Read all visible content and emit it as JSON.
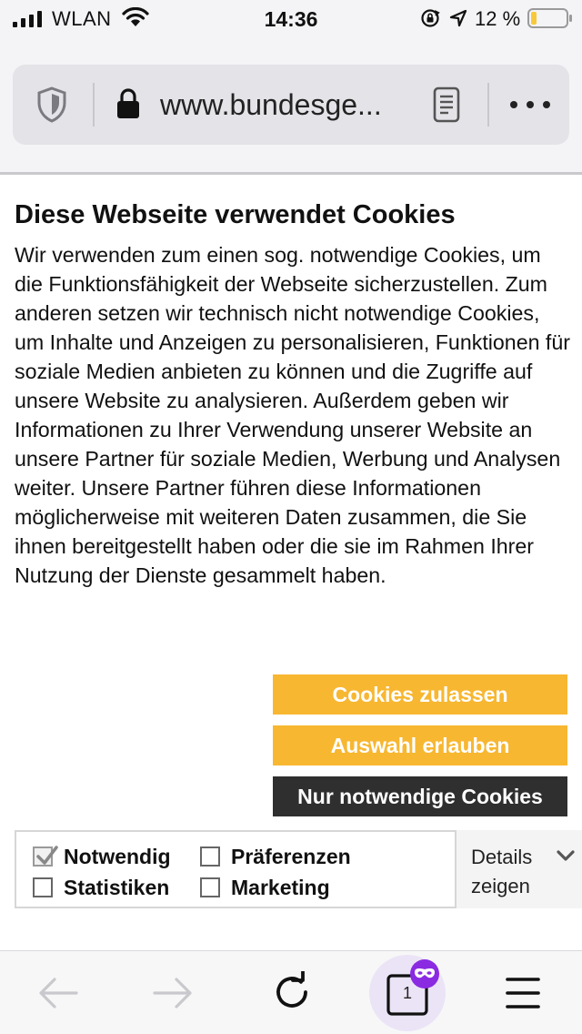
{
  "status_bar": {
    "carrier": "WLAN",
    "time": "14:36",
    "battery_percent": "12 %",
    "colors": {
      "battery_low": "#f7c93a"
    }
  },
  "browser": {
    "url": "www.bundesge...",
    "icons": [
      "shield-icon",
      "lock-icon",
      "reader-mode-icon",
      "more-icon"
    ]
  },
  "cookie_banner": {
    "title": "Diese Webseite verwendet Cookies",
    "body": "Wir verwenden zum einen sog. notwendige Cookies, um die Funktionsfähigkeit der Webseite sicherzustellen. Zum anderen setzen wir technisch nicht notwendige Cookies, um Inhalte und Anzeigen zu personalisieren, Funktionen für soziale Medien anbieten zu können und die Zugriffe auf unsere Website zu analysieren. Außerdem geben wir Informationen zu Ihrer Verwendung unserer Website an unsere Partner für soziale Medien, Werbung und Analysen weiter. Unsere Partner führen diese Informationen möglicherweise mit weiteren Daten zusammen, die Sie ihnen bereitgestellt haben oder die sie im Rahmen Ihrer Nutzung der Dienste gesammelt haben.",
    "buttons": {
      "allow_all": "Cookies zulassen",
      "allow_selection": "Auswahl erlauben",
      "necessary_only": "Nur notwendige Cookies"
    },
    "checkboxes": [
      {
        "label": "Notwendig",
        "checked": true
      },
      {
        "label": "Präferenzen",
        "checked": false
      },
      {
        "label": "Statistiken",
        "checked": false
      },
      {
        "label": "Marketing",
        "checked": false
      }
    ],
    "details": "Details zeigen",
    "colors": {
      "accent": "#f7b731",
      "dark_button": "#2f2f2f"
    }
  },
  "toolbar": {
    "tab_count": "1",
    "icons": [
      "back-arrow-icon",
      "forward-arrow-icon",
      "reload-icon",
      "tabs-icon",
      "private-mask-icon",
      "menu-icon"
    ],
    "colors": {
      "private_badge": "#8a2be2"
    }
  }
}
